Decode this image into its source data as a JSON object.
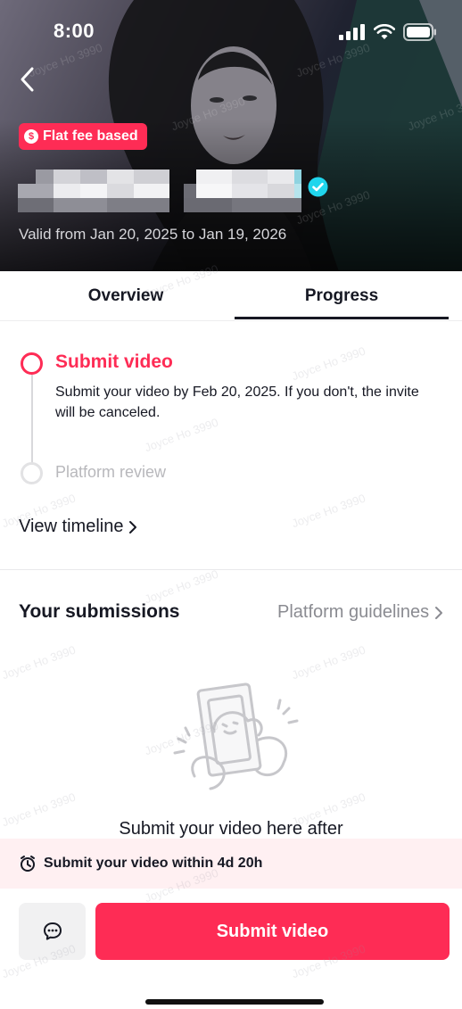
{
  "status_bar": {
    "time": "8:00"
  },
  "header": {
    "badge_label": "Flat fee based",
    "badge_icon": "dollar-icon",
    "valid_text": "Valid from Jan 20, 2025 to Jan 19, 2026"
  },
  "tabs": [
    {
      "label": "Overview",
      "selected": false
    },
    {
      "label": "Progress",
      "selected": true
    }
  ],
  "progress": {
    "current_step": {
      "title": "Submit video",
      "description": "Submit your video by Feb 20, 2025. If you don't, the invite will be canceled."
    },
    "next_step": {
      "title": "Platform review"
    },
    "view_timeline_label": "View timeline"
  },
  "submissions": {
    "title": "Your submissions",
    "guidelines_label": "Platform guidelines",
    "empty_text": "Submit your video here after"
  },
  "deadline": {
    "text": "Submit your video within 4d 20h"
  },
  "actions": {
    "submit_label": "Submit video"
  },
  "watermark": {
    "text": "Joyce Ho 3990"
  },
  "colors": {
    "accent": "#fe2c55",
    "text": "#161823",
    "muted": "#8a8b91",
    "deadline_bg": "#fff0f2"
  }
}
